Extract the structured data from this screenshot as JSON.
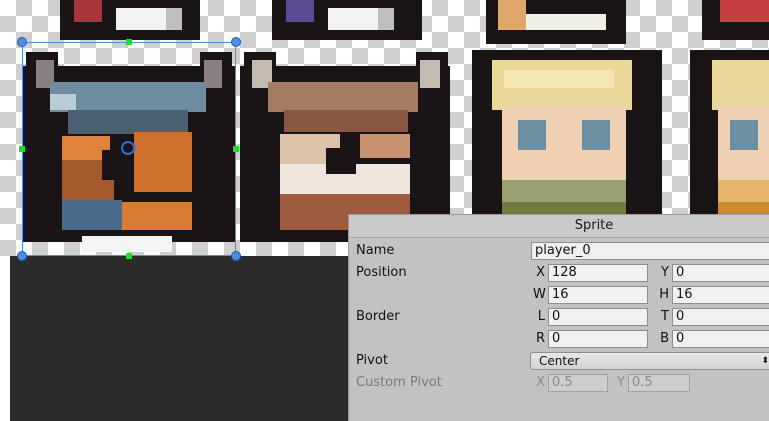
{
  "panel": {
    "title": "Sprite",
    "name_label": "Name",
    "name_value": "player_0",
    "position_label": "Position",
    "x_label": "X",
    "x_value": "128",
    "y_label": "Y",
    "y_value": "0",
    "w_label": "W",
    "w_value": "16",
    "h_label": "H",
    "h_value": "16",
    "border_label": "Border",
    "l_label": "L",
    "l_value": "0",
    "t_label": "T",
    "t_value": "0",
    "r_label": "R",
    "r_value": "0",
    "b_label": "B",
    "b_value": "0",
    "pivot_label": "Pivot",
    "pivot_value": "Center",
    "pivot_arrow": "⬍",
    "custom_pivot_label": "Custom Pivot",
    "cx_label": "X",
    "cx_value": "0.5",
    "cy_label": "Y",
    "cy_value": "0.5"
  },
  "colors": {
    "selection": "#4a90e2",
    "handle_green": "#22dd22",
    "panel_bg": "#c2c2c2",
    "dark_floor": "#2b2b2b"
  }
}
